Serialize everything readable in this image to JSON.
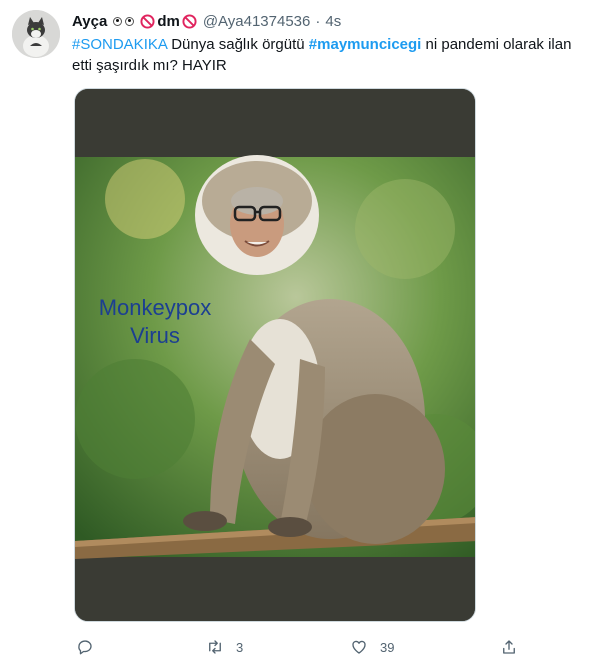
{
  "user": {
    "display_name": "Ayça",
    "dm_label": "dm",
    "handle": "@Aya41374536",
    "separator": "·",
    "time": "4s"
  },
  "tweet": {
    "line1_hashtag1": "#SONDAKIKA",
    "line1_text1": " Dünya sağlık örgütü ",
    "line1_hashtag2": "#maymuncicegi",
    "line1_text2": " ni pandemi olarak ilan",
    "line2_text": "etti şaşırdık mı? HAYIR"
  },
  "media": {
    "overlay_line1": "Monkeypox",
    "overlay_line2": "Virus"
  },
  "actions": {
    "reply_icon": "reply-icon",
    "retweet_icon": "retweet-icon",
    "retweet_count": "3",
    "like_icon": "heart-icon",
    "like_count": "39",
    "share_icon": "share-icon"
  },
  "colors": {
    "link": "#1d9bf0",
    "muted": "#536471",
    "overlay_text": "#1c3f91",
    "media_bg": "#3a3b34"
  }
}
